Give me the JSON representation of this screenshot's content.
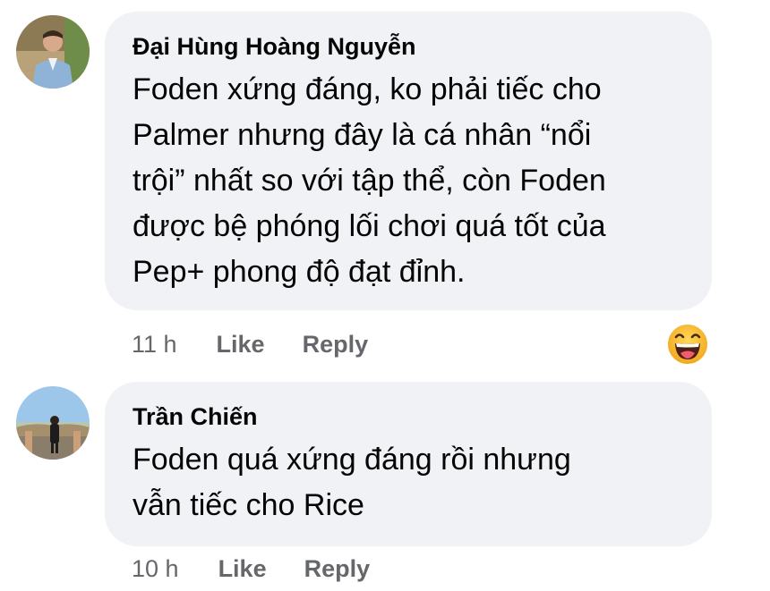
{
  "comments": [
    {
      "author": "Đại Hùng Hoàng Nguyễn",
      "text": "Foden xứng đáng, ko phải tiếc cho\nPalmer nhưng đây là cá nhân “nổi\ntrội” nhất so với tập thể, còn Foden\nđược bệ phóng lối chơi quá tốt của\nPep+ phong độ đạt đỉnh.",
      "time": "11 h",
      "like_label": "Like",
      "reply_label": "Reply",
      "reaction_icon": "haha-emoji-icon"
    },
    {
      "author": "Trần Chiến",
      "text": "Foden quá xứng đáng rồi nhưng\nvẫn tiếc cho Rice",
      "time": "10 h",
      "like_label": "Like",
      "reply_label": "Reply"
    }
  ],
  "colors": {
    "bubble": "#f0f2f5",
    "text": "#050505",
    "meta": "#65676b",
    "reaction": "#f7b125"
  }
}
